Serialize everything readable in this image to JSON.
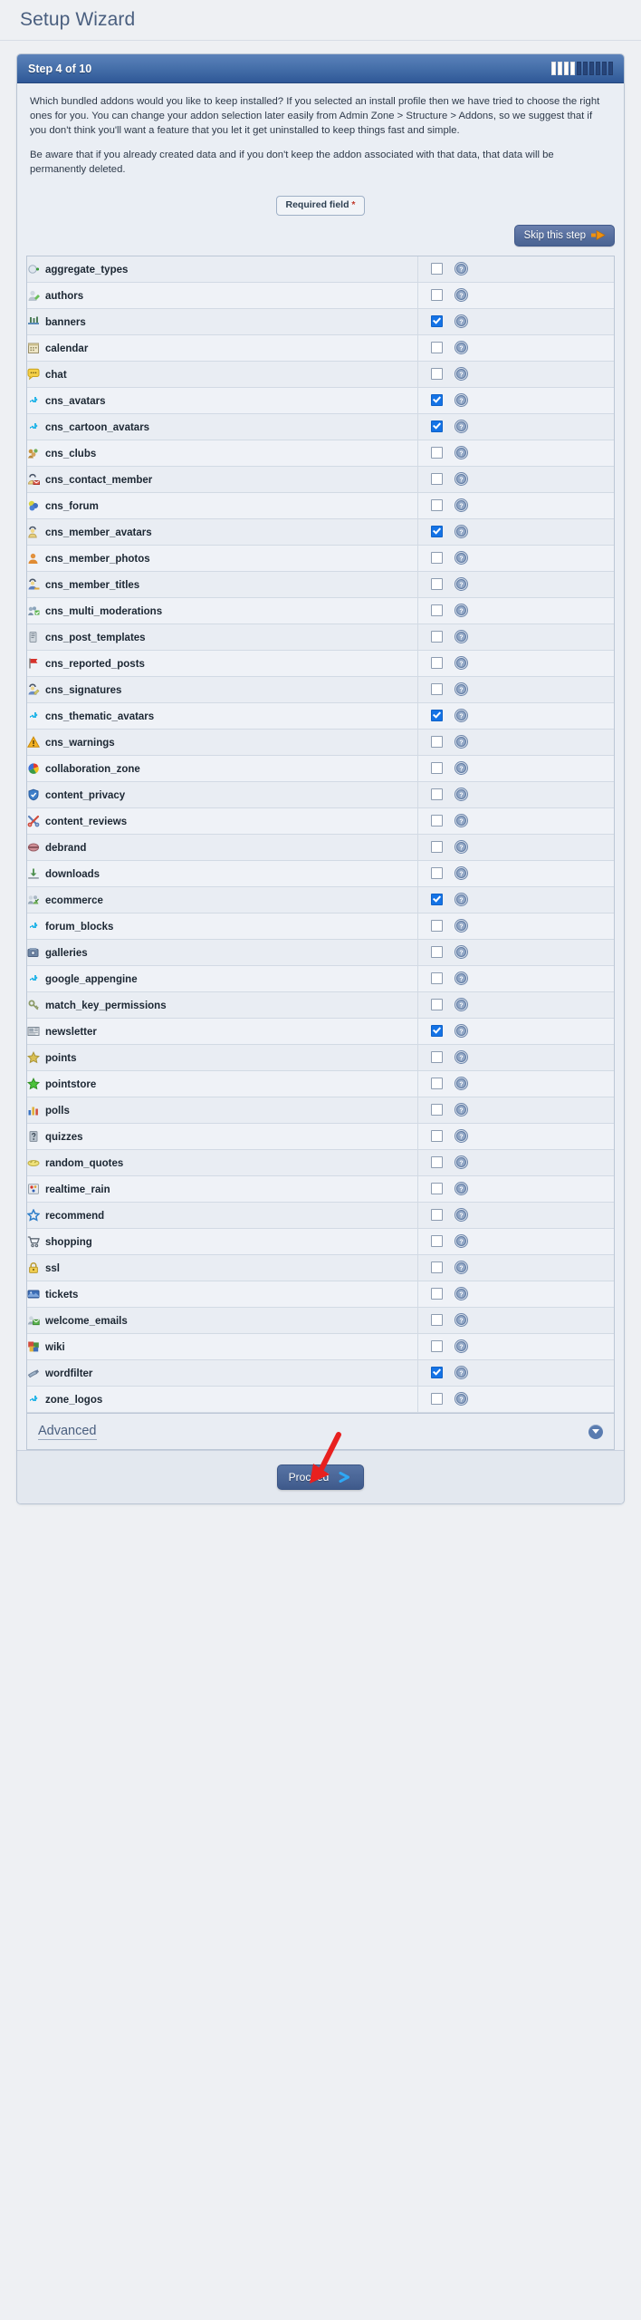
{
  "page": {
    "title": "Setup Wizard"
  },
  "wizard": {
    "step_label": "Step 4 of 10",
    "progress": {
      "total": 10,
      "completed": 4
    },
    "intro_paragraph_1": "Which bundled addons would you like to keep installed? If you selected an install profile then we have tried to choose the right ones for you. You can change your addon selection later easily from Admin Zone > Structure > Addons, so we suggest that if you don't think you'll want a feature that you let it get uninstalled to keep things fast and simple.",
    "intro_paragraph_2": "Be aware that if you already created data and if you don't keep the addon associated with that data, that data will be permanently deleted.",
    "required_field_label": "Required field",
    "required_field_star": "*",
    "skip_button_label": "Skip this step",
    "advanced_label": "Advanced",
    "proceed_button_label": "Proceed"
  },
  "colors": {
    "header_blue": "#2f5897",
    "accent_blue": "#1473e6",
    "button_blue": "#4a6492",
    "orange_arrow": "#f0900f",
    "annotation_red": "#e8201f",
    "title_text": "#4a5f7f"
  },
  "addons": [
    {
      "name": "aggregate_types",
      "icon": "aggregate-types-icon",
      "checked": false
    },
    {
      "name": "authors",
      "icon": "authors-icon",
      "checked": false
    },
    {
      "name": "banners",
      "icon": "banners-icon",
      "checked": true
    },
    {
      "name": "calendar",
      "icon": "calendar-icon",
      "checked": false
    },
    {
      "name": "chat",
      "icon": "chat-icon",
      "checked": false
    },
    {
      "name": "cns_avatars",
      "icon": "puzzle-icon",
      "checked": true
    },
    {
      "name": "cns_cartoon_avatars",
      "icon": "puzzle-icon",
      "checked": true
    },
    {
      "name": "cns_clubs",
      "icon": "clubs-icon",
      "checked": false
    },
    {
      "name": "cns_contact_member",
      "icon": "contact-member-icon",
      "checked": false
    },
    {
      "name": "cns_forum",
      "icon": "forum-icon",
      "checked": false
    },
    {
      "name": "cns_member_avatars",
      "icon": "member-avatar-icon",
      "checked": true
    },
    {
      "name": "cns_member_photos",
      "icon": "member-photo-icon",
      "checked": false
    },
    {
      "name": "cns_member_titles",
      "icon": "member-title-icon",
      "checked": false
    },
    {
      "name": "cns_multi_moderations",
      "icon": "multi-moderations-icon",
      "checked": false
    },
    {
      "name": "cns_post_templates",
      "icon": "post-templates-icon",
      "checked": false
    },
    {
      "name": "cns_reported_posts",
      "icon": "red-flag-icon",
      "checked": false
    },
    {
      "name": "cns_signatures",
      "icon": "signatures-icon",
      "checked": false
    },
    {
      "name": "cns_thematic_avatars",
      "icon": "puzzle-icon",
      "checked": true
    },
    {
      "name": "cns_warnings",
      "icon": "warning-triangle-icon",
      "checked": false
    },
    {
      "name": "collaboration_zone",
      "icon": "collaboration-icon",
      "checked": false
    },
    {
      "name": "content_privacy",
      "icon": "shield-icon",
      "checked": false
    },
    {
      "name": "content_reviews",
      "icon": "tools-icon",
      "checked": false
    },
    {
      "name": "debrand",
      "icon": "debrand-icon",
      "checked": false
    },
    {
      "name": "downloads",
      "icon": "download-icon",
      "checked": false
    },
    {
      "name": "ecommerce",
      "icon": "ecommerce-icon",
      "checked": true
    },
    {
      "name": "forum_blocks",
      "icon": "puzzle-icon",
      "checked": false
    },
    {
      "name": "galleries",
      "icon": "galleries-icon",
      "checked": false
    },
    {
      "name": "google_appengine",
      "icon": "puzzle-icon",
      "checked": false
    },
    {
      "name": "match_key_permissions",
      "icon": "key-permissions-icon",
      "checked": false
    },
    {
      "name": "newsletter",
      "icon": "newsletter-icon",
      "checked": true
    },
    {
      "name": "points",
      "icon": "gold-star-icon",
      "checked": false
    },
    {
      "name": "pointstore",
      "icon": "green-star-icon",
      "checked": false
    },
    {
      "name": "polls",
      "icon": "bar-chart-icon",
      "checked": false
    },
    {
      "name": "quizzes",
      "icon": "quiz-icon",
      "checked": false
    },
    {
      "name": "random_quotes",
      "icon": "quotes-icon",
      "checked": false
    },
    {
      "name": "realtime_rain",
      "icon": "realtime-rain-icon",
      "checked": false
    },
    {
      "name": "recommend",
      "icon": "blue-star-icon",
      "checked": false
    },
    {
      "name": "shopping",
      "icon": "cart-icon",
      "checked": false
    },
    {
      "name": "ssl",
      "icon": "lock-icon",
      "checked": false
    },
    {
      "name": "tickets",
      "icon": "tickets-icon",
      "checked": false
    },
    {
      "name": "welcome_emails",
      "icon": "welcome-emails-icon",
      "checked": false
    },
    {
      "name": "wiki",
      "icon": "wiki-icon",
      "checked": false
    },
    {
      "name": "wordfilter",
      "icon": "wordfilter-icon",
      "checked": true
    },
    {
      "name": "zone_logos",
      "icon": "puzzle-icon",
      "checked": false
    }
  ],
  "help_icon_name": "help-question-icon"
}
